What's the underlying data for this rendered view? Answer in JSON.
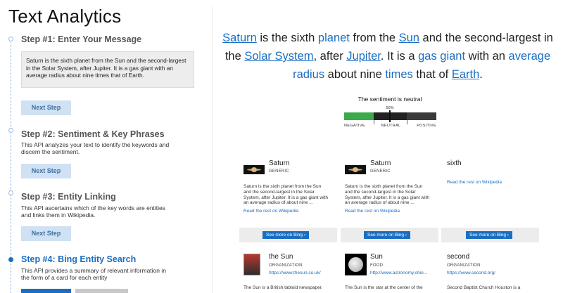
{
  "app": {
    "title": "Text Analytics"
  },
  "steps": [
    {
      "title": "Step #1: Enter Your Message",
      "description": "",
      "button": "Next Step"
    },
    {
      "title": "Step #2: Sentiment & Key Phrases",
      "description": "This API analyzes your text to identify the keywords and discern the sentiment.",
      "button": "Next Step"
    },
    {
      "title": "Step #3: Entity Linking",
      "description": "This API ascertains which of the key words are entities and links them in Wikipedia.",
      "button": "Next Step"
    },
    {
      "title": "Step #4: Bing Entity Search",
      "description": "This API provides a summary of relevant information in the form of a card for each entity",
      "button": ""
    }
  ],
  "message": {
    "text": "Saturn is the sixth planet from the Sun and the second-largest in the Solar System, after Jupiter. It is a gas giant with an average radius about nine times that of Earth."
  },
  "hero": {
    "w1": "Saturn",
    "t1": " is the sixth ",
    "w2": "planet",
    "t2": " from the ",
    "w3": "Sun",
    "t3": " and the second-largest in the ",
    "w4": "Solar System",
    "t4": ", after ",
    "w5": "Jupiter",
    "t5": ". It is a ",
    "w6": "gas giant",
    "t6": " with an ",
    "w7": "average radius",
    "t7": " about nine ",
    "w8": "times",
    "t8": " that of ",
    "w9": "Earth",
    "t9": "."
  },
  "sentiment": {
    "label": "The sentiment is neutral",
    "percent": "50%",
    "value": 0.5,
    "axis": [
      "NEGATIVE",
      "NEUTRAL",
      "POSITIVE"
    ],
    "colors": {
      "negative": "#3aaa4a",
      "neutral": "#222222",
      "positive": "#3a3a3a"
    }
  },
  "cards": [
    {
      "name": "Saturn",
      "type": "GENERIC",
      "url": "",
      "icon": "saturn-image",
      "desc": "Saturn is the sixth planet from the Sun and the second-largest in the Solar System, after Jupiter. It is a gas giant with an average radius of about nine ...",
      "rest": "Read the rest on Wikipedia"
    },
    {
      "name": "Saturn",
      "type": "GENERIC",
      "url": "",
      "icon": "saturn-image",
      "desc": "Saturn is the sixth planet from the Sun and the second-largest in the Solar System, after Jupiter. It is a gas giant with an average radius of about nine ...",
      "rest": "Read the rest on Wikipedia"
    },
    {
      "name": "sixth",
      "type": "",
      "url": "",
      "icon": "",
      "desc": "",
      "rest": "Read the rest on Wikipedia"
    },
    {
      "name": "the Sun",
      "type": "ORGANIZATION",
      "url": "https://www.thesun.co.uk/",
      "icon": "newspaper-image",
      "desc": "The Sun is a British tabloid newspaper.",
      "rest": ""
    },
    {
      "name": "Sun",
      "type": "FOOD",
      "url": "http://www.astronomy.ohio...",
      "icon": "sun-image",
      "desc": "The Sun is the star at the center of the",
      "rest": ""
    },
    {
      "name": "second",
      "type": "ORGANIZATION",
      "url": "https://www.second.org/",
      "icon": "",
      "desc": "Second Baptist Church Houston is a",
      "rest": ""
    }
  ],
  "bing": {
    "button": "See more on Bing ›"
  },
  "accent": "#1a6ec2"
}
